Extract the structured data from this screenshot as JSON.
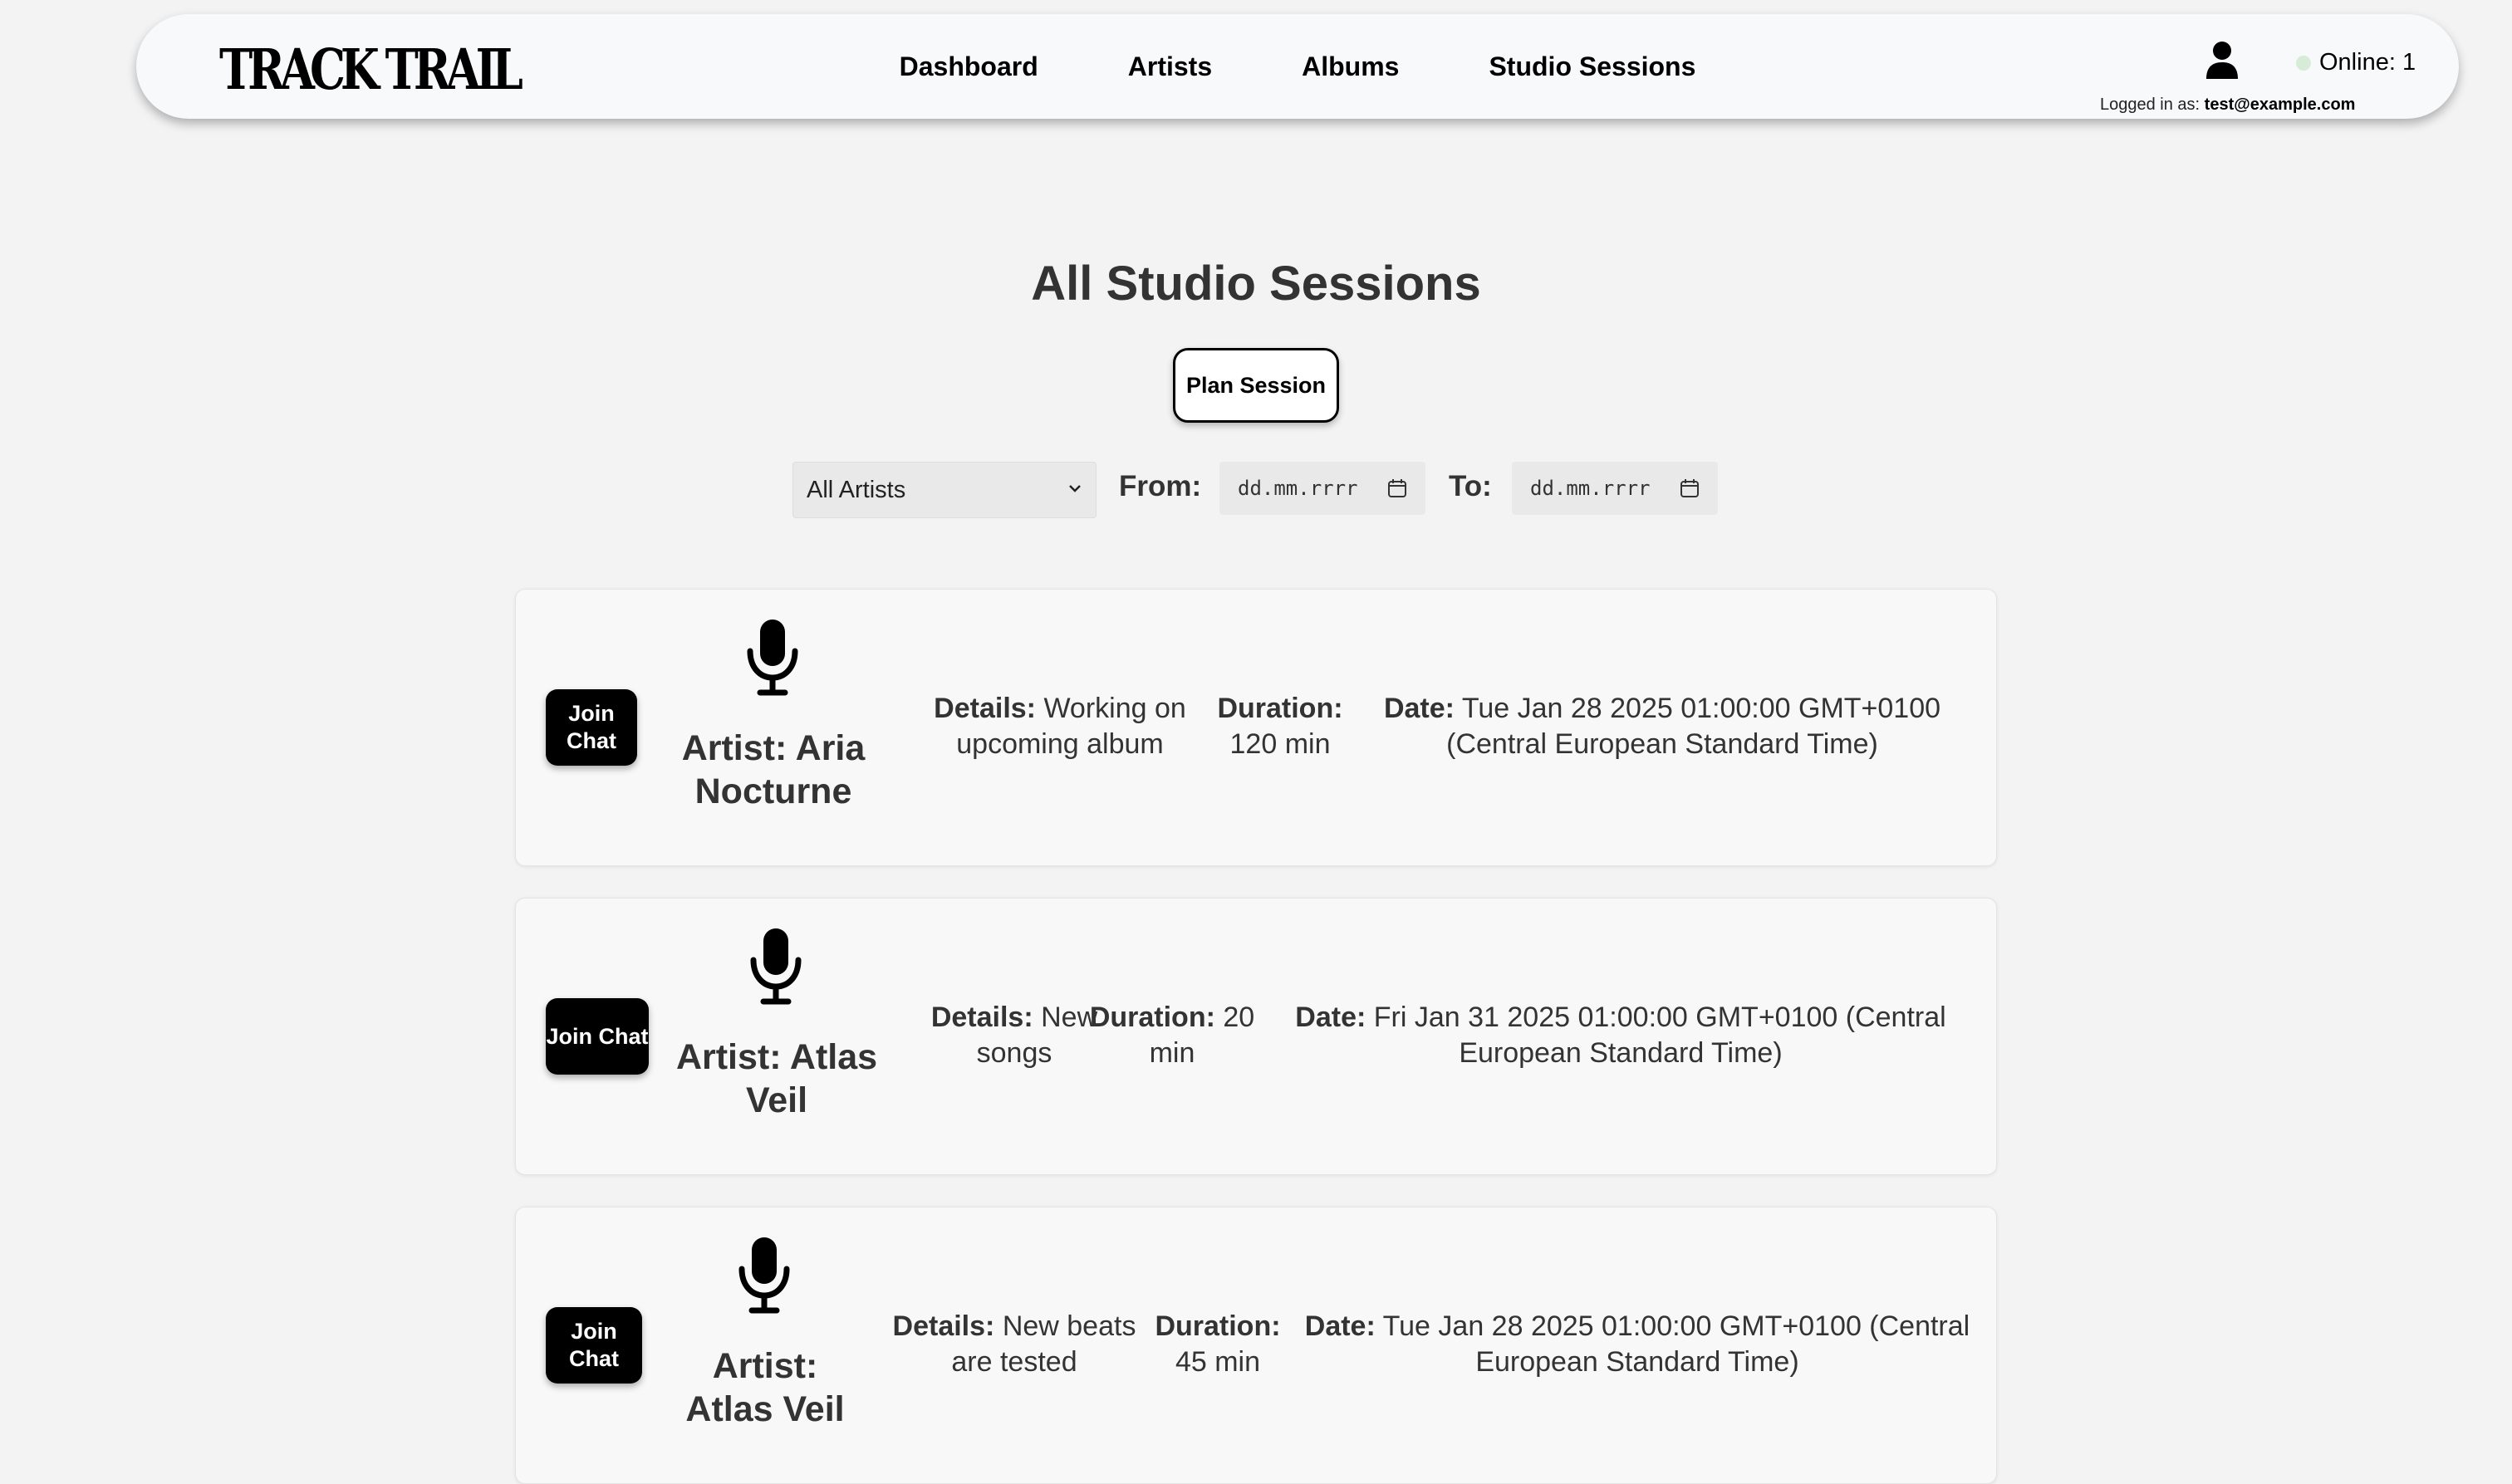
{
  "app": {
    "logo_text": "TRACK TRAIL"
  },
  "nav": {
    "links": [
      "Dashboard",
      "Artists",
      "Albums",
      "Studio Sessions"
    ],
    "online_label": "Online: 1",
    "logged_prefix": "Logged in as:",
    "logged_user": "test@example.com"
  },
  "page": {
    "title": "All Studio Sessions",
    "plan_button": "Plan Session"
  },
  "filters": {
    "artist_select": "All Artists",
    "from_label": "From:",
    "to_label": "To:",
    "from_placeholder": "dd.mm.rrrr",
    "to_placeholder": "dd.mm.rrrr"
  },
  "sessions": [
    {
      "join_label": "Join Chat",
      "artist": "Artist: Aria Nocturne",
      "details_label": "Details:",
      "details": "Working on upcoming album",
      "duration_label": "Duration:",
      "duration": "120 min",
      "date_label": "Date:",
      "date": "Tue Jan 28 2025 01:00:00 GMT+0100 (Central European Standard Time)"
    },
    {
      "join_label": "Join Chat",
      "artist": "Artist: Atlas Veil",
      "details_label": "Details:",
      "details": "New songs",
      "duration_label": "Duration:",
      "duration": "20 min",
      "date_label": "Date:",
      "date": "Fri Jan 31 2025 01:00:00 GMT+0100 (Central European Standard Time)"
    },
    {
      "join_label": "Join Chat",
      "artist": "Artist: Atlas Veil",
      "details_label": "Details:",
      "details": "New beats are tested",
      "duration_label": "Duration:",
      "duration": "45 min",
      "date_label": "Date:",
      "date": "Tue Jan 28 2025 01:00:00 GMT+0100 (Central European Standard Time)"
    }
  ]
}
